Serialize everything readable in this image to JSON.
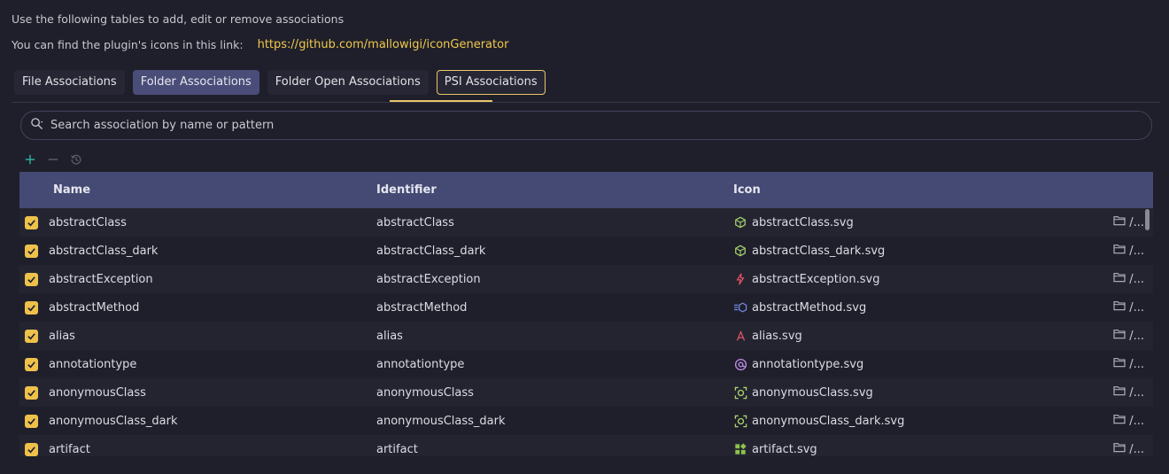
{
  "intro": "Use the following tables to add, edit or remove associations",
  "link_label": "You can find the plugin's icons in this link:",
  "link_url": "https://github.com/mallowigi/iconGenerator",
  "tabs": [
    {
      "label": "File Associations",
      "state": "normal"
    },
    {
      "label": "Folder Associations",
      "state": "hover"
    },
    {
      "label": "Folder Open Associations",
      "state": "normal"
    },
    {
      "label": "PSI Associations",
      "state": "active"
    }
  ],
  "search": {
    "placeholder": "Search association by name or pattern"
  },
  "toolbar": {
    "add_icon": "plus-icon",
    "remove_icon": "minus-icon",
    "reset_icon": "history-icon",
    "accent": "#2bb5a0"
  },
  "table": {
    "headers": {
      "name": "Name",
      "identifier": "Identifier",
      "icon": "Icon"
    },
    "path_label": "/...",
    "rows": [
      {
        "checked": true,
        "name": "abstractClass",
        "identifier": "abstractClass",
        "icon": "abstractClass.svg",
        "glyph": "cube-icon",
        "glyph_color": "#a8d66a"
      },
      {
        "checked": true,
        "name": "abstractClass_dark",
        "identifier": "abstractClass_dark",
        "icon": "abstractClass_dark.svg",
        "glyph": "cube-icon",
        "glyph_color": "#a8d66a"
      },
      {
        "checked": true,
        "name": "abstractException",
        "identifier": "abstractException",
        "icon": "abstractException.svg",
        "glyph": "bolt-icon",
        "glyph_color": "#e25563"
      },
      {
        "checked": true,
        "name": "abstractMethod",
        "identifier": "abstractMethod",
        "icon": "abstractMethod.svg",
        "glyph": "method-icon",
        "glyph_color": "#7a8ef0"
      },
      {
        "checked": true,
        "name": "alias",
        "identifier": "alias",
        "icon": "alias.svg",
        "glyph": "letter-a-icon",
        "glyph_color": "#e25563"
      },
      {
        "checked": true,
        "name": "annotationtype",
        "identifier": "annotationtype",
        "icon": "annotationtype.svg",
        "glyph": "at-icon",
        "glyph_color": "#c08de8"
      },
      {
        "checked": true,
        "name": "anonymousClass",
        "identifier": "anonymousClass",
        "icon": "anonymousClass.svg",
        "glyph": "anon-class-icon",
        "glyph_color": "#a8d66a"
      },
      {
        "checked": true,
        "name": "anonymousClass_dark",
        "identifier": "anonymousClass_dark",
        "icon": "anonymousClass_dark.svg",
        "glyph": "anon-class-icon",
        "glyph_color": "#a8d66a"
      },
      {
        "checked": true,
        "name": "artifact",
        "identifier": "artifact",
        "icon": "artifact.svg",
        "glyph": "artifact-icon",
        "glyph_color": "#8bc34a"
      }
    ]
  }
}
